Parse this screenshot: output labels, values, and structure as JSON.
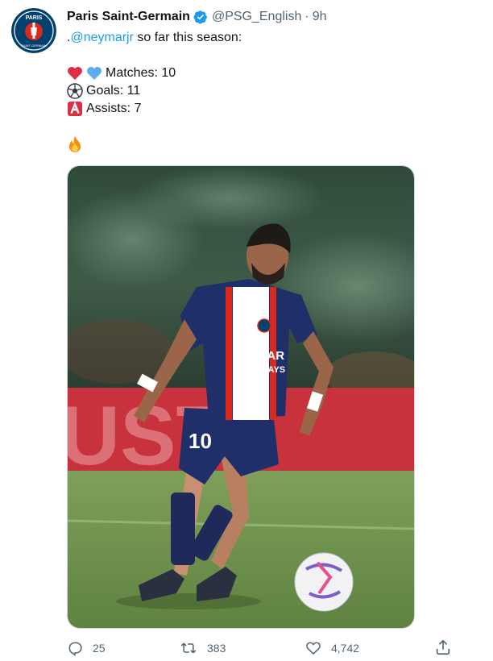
{
  "tweet": {
    "author_name": "Paris Saint-Germain",
    "handle": "@PSG_English",
    "separator": "·",
    "time": "9h",
    "text_prefix": ".",
    "mention": "@neymarjr",
    "text_suffix": " so far this season:",
    "stats": {
      "matches": "Matches: 10",
      "goals": "Goals: 11",
      "assists": "Assists: 7"
    },
    "fire_emoji": "🔥",
    "avatar_logo": {
      "top_text": "PARIS",
      "bottom_text": "SAINT-GERMAIN"
    },
    "media": {
      "sponsor_line1": "QATAR",
      "sponsor_line2": "AIRWAYS",
      "shirt_number": "10",
      "background_text": "UST"
    }
  },
  "actions": {
    "reply_count": "25",
    "retweet_count": "383",
    "like_count": "4,742"
  },
  "colors": {
    "verified": "#1d9bf0",
    "mention": "#1d9bf0",
    "muted": "#536471",
    "psg_navy": "#004170",
    "psg_red": "#da291c"
  }
}
